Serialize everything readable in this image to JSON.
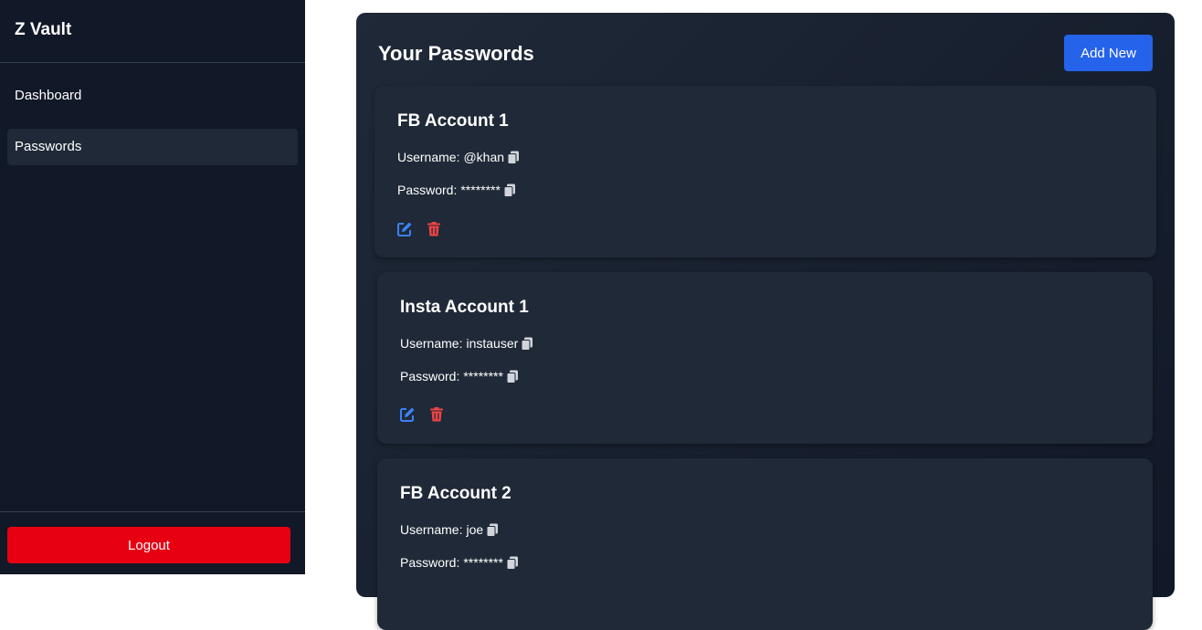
{
  "sidebar": {
    "brand": "Z Vault",
    "items": [
      {
        "label": "Dashboard",
        "active": false
      },
      {
        "label": "Passwords",
        "active": true
      }
    ],
    "logout_label": "Logout"
  },
  "main": {
    "title": "Your Passwords",
    "add_new_label": "Add New",
    "cards": [
      {
        "title": "FB Account 1",
        "username_label": "Username:",
        "username": "@khan",
        "password_label": "Password:",
        "password": "********"
      },
      {
        "title": "Insta Account 1",
        "username_label": "Username:",
        "username": "instauser",
        "password_label": "Password:",
        "password": "********"
      },
      {
        "title": "FB Account 2",
        "username_label": "Username:",
        "username": "joe",
        "password_label": "Password:",
        "password": "********"
      }
    ]
  },
  "colors": {
    "sidebar_bg": "#111827",
    "card_bg": "#1f2937",
    "primary": "#2563eb",
    "danger": "#e60012",
    "edit_icon": "#3b82f6",
    "delete_icon": "#ef4444"
  },
  "icons": {
    "copy": "copy-icon",
    "edit": "edit-icon",
    "delete": "trash-icon"
  }
}
